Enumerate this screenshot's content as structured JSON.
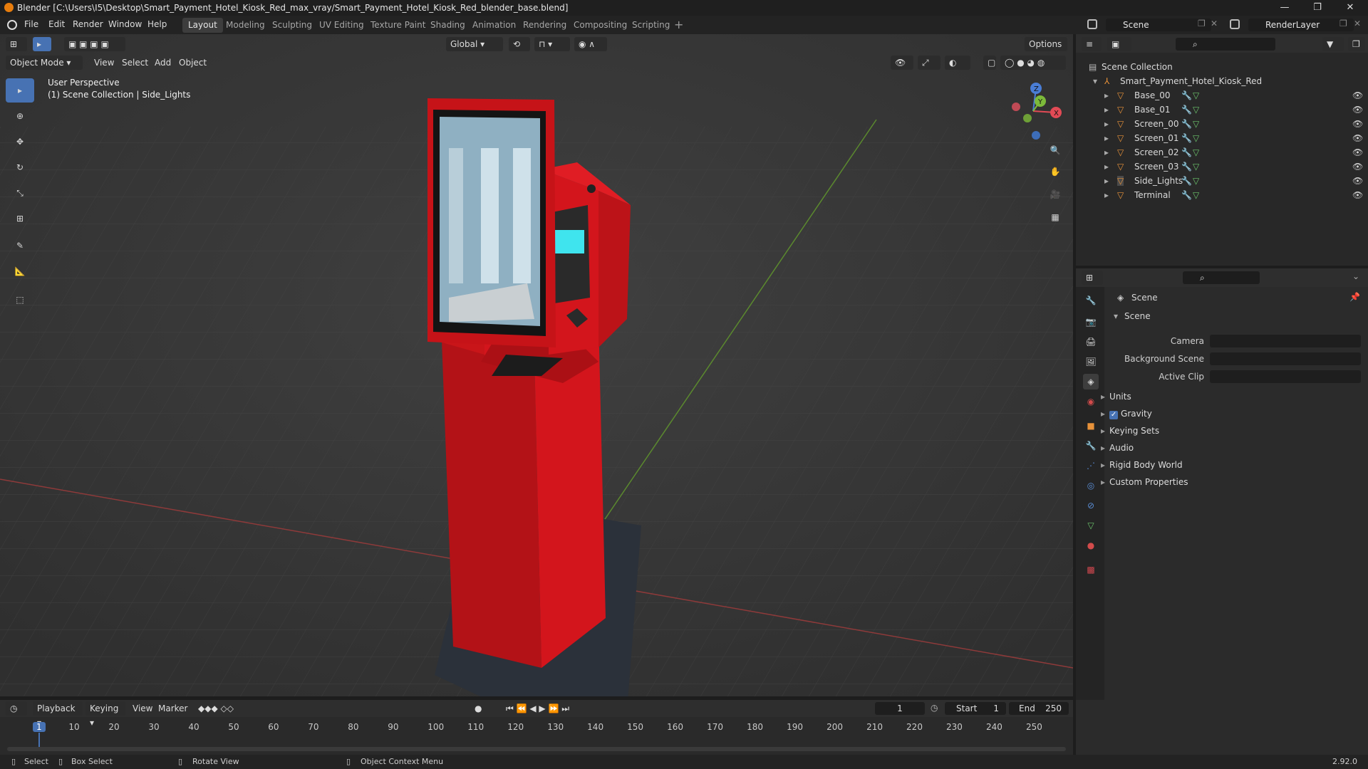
{
  "window": {
    "title": "Blender [C:\\Users\\I5\\Desktop\\Smart_Payment_Hotel_Kiosk_Red_max_vray/Smart_Payment_Hotel_Kiosk_Red_blender_base.blend]",
    "controls": [
      "—",
      "❐",
      "✕"
    ]
  },
  "menu": [
    "File",
    "Edit",
    "Render",
    "Window",
    "Help"
  ],
  "workspaces": [
    "Layout",
    "Modeling",
    "Sculpting",
    "UV Editing",
    "Texture Paint",
    "Shading",
    "Animation",
    "Rendering",
    "Compositing",
    "Scripting"
  ],
  "active_workspace": "Layout",
  "scene_selector": "Scene",
  "view_layer": "RenderLayer",
  "viewport": {
    "mode": "Object Mode",
    "menus": [
      "View",
      "Select",
      "Add",
      "Object"
    ],
    "transform_orientation": "Global",
    "options_label": "Options",
    "overlay_title": "User Perspective",
    "overlay_subtitle": "(1) Scene Collection | Side_Lights",
    "gizmo_axes": {
      "x": "X",
      "y": "Y",
      "z": "Z"
    },
    "tools": [
      "select-box",
      "cursor",
      "move",
      "rotate",
      "scale",
      "transform",
      "annotate",
      "measure",
      "add-cube"
    ],
    "nav_icons": [
      "zoom-icon",
      "hand-pan-icon",
      "camera-icon",
      "grid-perspective-icon"
    ]
  },
  "outliner": {
    "root": "Scene Collection",
    "collection": "Smart_Payment_Hotel_Kiosk_Red",
    "objects": [
      "Base_00",
      "Base_01",
      "Screen_00",
      "Screen_01",
      "Screen_02",
      "Screen_03",
      "Side_Lights",
      "Terminal"
    ],
    "selected": "Side_Lights"
  },
  "properties": {
    "context": "Scene",
    "panel": "Scene",
    "fields": [
      {
        "label": "Camera",
        "value": ""
      },
      {
        "label": "Background Scene",
        "value": ""
      },
      {
        "label": "Active Clip",
        "value": ""
      }
    ],
    "sections": [
      "Units",
      "Gravity",
      "Keying Sets",
      "Audio",
      "Rigid Body World",
      "Custom Properties"
    ],
    "gravity_checked": true
  },
  "timeline": {
    "menus": [
      "Playback",
      "Keying",
      "View",
      "Marker"
    ],
    "current_frame": "1",
    "start_label": "Start",
    "start": "1",
    "end_label": "End",
    "end": "250",
    "ticks": [
      "1",
      "10",
      "20",
      "30",
      "40",
      "50",
      "60",
      "70",
      "80",
      "90",
      "100",
      "110",
      "120",
      "130",
      "140",
      "150",
      "160",
      "170",
      "180",
      "190",
      "200",
      "210",
      "220",
      "230",
      "240",
      "250"
    ]
  },
  "statusbar": {
    "items": [
      "Select",
      "Box Select",
      "Rotate View",
      "Object Context Menu"
    ],
    "version": "2.92.0"
  },
  "colors": {
    "accent": "#4772b3",
    "kiosk_red": "#d3151c",
    "object_orange": "#e8923a",
    "mesh_green": "#6cc56c"
  }
}
